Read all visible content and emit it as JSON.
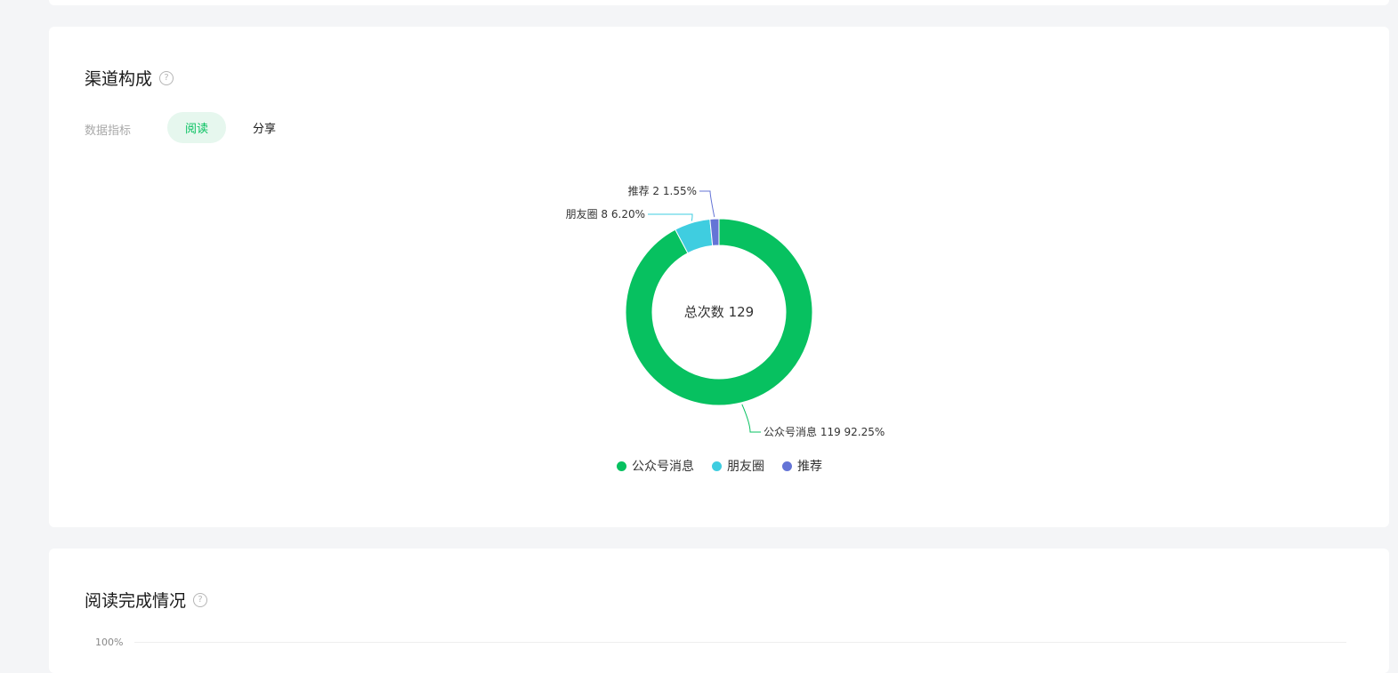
{
  "channel": {
    "title": "渠道构成",
    "help_icon": "question-circle-icon",
    "metric_label": "数据指标",
    "tabs": [
      {
        "label": "阅读",
        "active": true
      },
      {
        "label": "分享",
        "active": false
      }
    ],
    "center_text": "总次数 129",
    "colors": {
      "accent": "#07c160",
      "active_tab_bg": "#e6f7ee"
    }
  },
  "chart_data": {
    "type": "pie",
    "total": 129,
    "series": [
      {
        "name": "公众号消息",
        "value": 119,
        "percent": 92.25,
        "color": "#07c160",
        "callout": "公众号消息 119 92.25%"
      },
      {
        "name": "朋友圈",
        "value": 8,
        "percent": 6.2,
        "color": "#3fcde0",
        "callout": "朋友圈 8 6.20%"
      },
      {
        "name": "推荐",
        "value": 2,
        "percent": 1.55,
        "color": "#6474d6",
        "callout": "推荐 2 1.55%"
      }
    ],
    "legend_position": "bottom"
  },
  "completion": {
    "title": "阅读完成情况",
    "help_icon": "question-circle-icon",
    "y_tick_top": "100%"
  }
}
